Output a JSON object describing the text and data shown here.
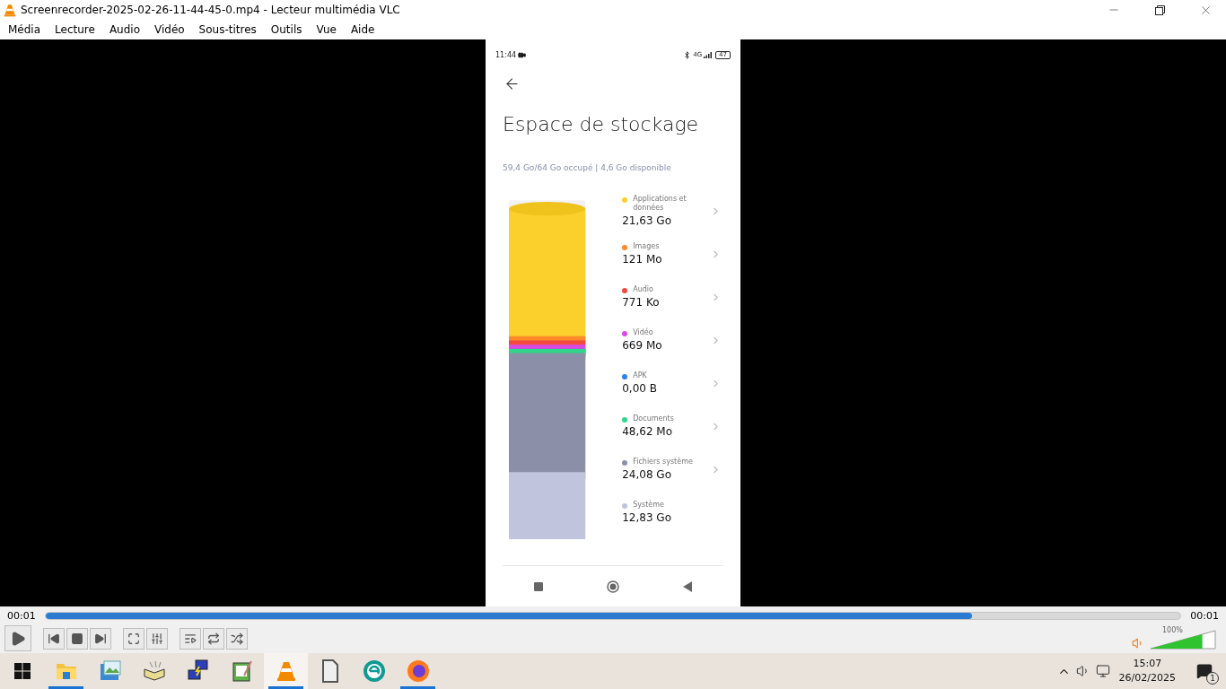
{
  "window": {
    "title": "Screenrecorder-2025-02-26-11-44-45-0.mp4 - Lecteur multimédia VLC"
  },
  "menu": [
    "Média",
    "Lecture",
    "Audio",
    "Vidéo",
    "Sous-titres",
    "Outils",
    "Vue",
    "Aide"
  ],
  "phone": {
    "time": "11:44",
    "network_type": "4G",
    "battery": "47",
    "title": "Espace de stockage",
    "summary": "59,4 Go/64 Go occupé | 4,6 Go disponible",
    "categories": [
      {
        "label": "Applications et données",
        "size": "21,63 Go",
        "color": "#fbd02d",
        "has_chevron": true
      },
      {
        "label": "Images",
        "size": "121 Mo",
        "color": "#ff8a2a",
        "has_chevron": true
      },
      {
        "label": "Audio",
        "size": "771 Ko",
        "color": "#f24a3d",
        "has_chevron": true
      },
      {
        "label": "Vidéo",
        "size": "669 Mo",
        "color": "#d94ae0",
        "has_chevron": true
      },
      {
        "label": "APK",
        "size": "0,00 B",
        "color": "#2f7ff0",
        "has_chevron": true
      },
      {
        "label": "Documents",
        "size": "48,62 Mo",
        "color": "#30d58a",
        "has_chevron": true
      },
      {
        "label": "Fichiers système",
        "size": "24,08 Go",
        "color": "#8c8fa8",
        "has_chevron": true
      },
      {
        "label": "Système",
        "size": "12,83 Go",
        "color": "#c0c4dc",
        "has_chevron": false
      }
    ]
  },
  "player": {
    "elapsed": "00:01",
    "total": "00:01",
    "seek": {
      "level": 0.816
    },
    "buttons": [
      {
        "kind": "play"
      },
      {
        "kind": "previous"
      },
      {
        "kind": "stop"
      },
      {
        "kind": "next"
      },
      {
        "kind": "fullscreen"
      },
      {
        "kind": "equalizer"
      },
      {
        "kind": "playlist"
      },
      {
        "kind": "loop"
      },
      {
        "kind": "shuffle"
      }
    ],
    "volume": {
      "label": "100%",
      "level": 0.8
    }
  },
  "taskbar": {
    "apps": [
      {
        "kind": "folder",
        "running": true,
        "selected": false
      },
      {
        "kind": "photos",
        "running": false,
        "selected": false
      },
      {
        "kind": "book",
        "running": false,
        "selected": false
      },
      {
        "kind": "network",
        "running": false,
        "selected": false
      },
      {
        "kind": "notepad",
        "running": false,
        "selected": false
      },
      {
        "kind": "vlc",
        "running": true,
        "selected": true
      },
      {
        "kind": "document",
        "running": false,
        "selected": false
      },
      {
        "kind": "eset",
        "running": false,
        "selected": false
      },
      {
        "kind": "firefox",
        "running": true,
        "selected": false
      }
    ],
    "time": "15:07",
    "date": "26/02/2025",
    "notifications": "1"
  }
}
